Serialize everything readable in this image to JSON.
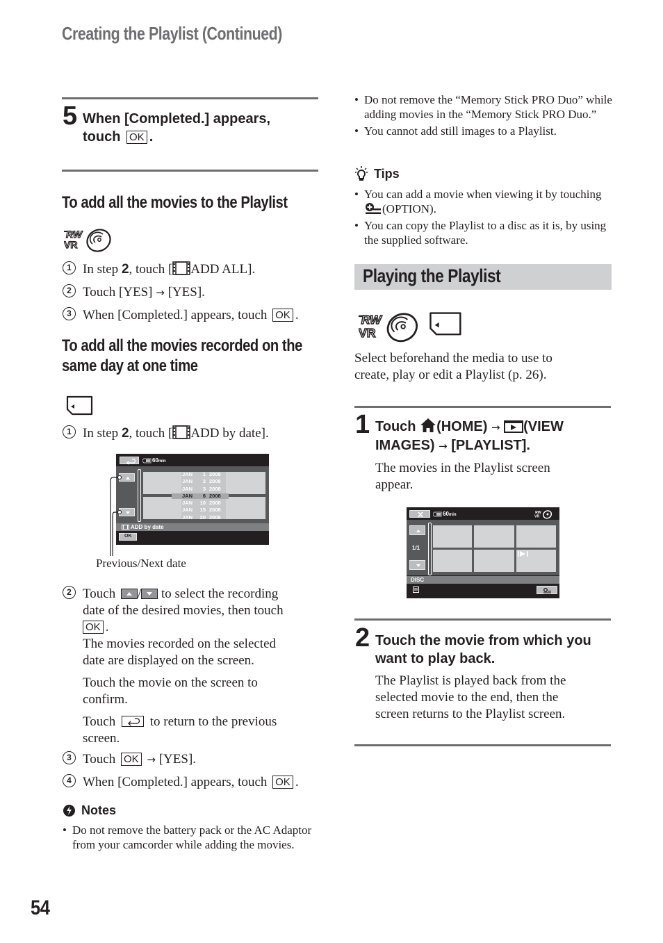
{
  "running_head": "Creating the Playlist (Continued)",
  "page_number": "54",
  "left": {
    "step5": {
      "number": "5",
      "title_line1": "When [Completed.] appears,",
      "title_line2_prefix": "touch",
      "ok_label": "OK",
      "title_suffix": "."
    },
    "add_all": {
      "heading": "To add all the movies to the Playlist",
      "media_icon": "dvd-rw-vr-disc-icon",
      "items": [
        {
          "num": "1",
          "pre": "In step ",
          "bold": "2",
          "mid": ", touch [",
          "icon": "film-strip-icon",
          "post": "ADD ALL]."
        },
        {
          "num": "2",
          "text": "Touch [YES] ",
          "arrow": "→",
          "post": " [YES]."
        },
        {
          "num": "3",
          "text": "When [Completed.] appears, touch",
          "ok": "OK",
          "post": "."
        }
      ]
    },
    "add_by_date": {
      "heading_line1": "To add all the movies recorded on the",
      "heading_line2": "same day at one time",
      "media_icon": "memory-stick-icon",
      "item1": {
        "num": "1",
        "pre": "In step ",
        "bold": "2",
        "mid": ", touch [",
        "icon": "film-strip-icon",
        "post": "ADD by date]."
      },
      "screen": {
        "back_icon": "return-icon",
        "battery_icon": "battery-icon",
        "remaining": "60",
        "remaining_unit": "min",
        "dates": [
          {
            "month": "JAN",
            "day": "1",
            "year": "2008",
            "selected": false
          },
          {
            "month": "JAN",
            "day": "2",
            "year": "2008",
            "selected": false
          },
          {
            "month": "JAN",
            "day": "3",
            "year": "2008",
            "selected": false
          },
          {
            "month": "JAN",
            "day": "6",
            "year": "2008",
            "selected": true
          },
          {
            "month": "JAN",
            "day": "10",
            "year": "2008",
            "selected": false
          },
          {
            "month": "JAN",
            "day": "15",
            "year": "2008",
            "selected": false
          },
          {
            "month": "JAN",
            "day": "20",
            "year": "2008",
            "selected": false
          }
        ],
        "status_label": "ADD by date",
        "ok_label": "OK"
      },
      "callout": "Previous/Next date",
      "item2": {
        "num": "2",
        "pre": "Touch",
        "up_icon": "up-arrow-button-icon",
        "slash": "/",
        "down_icon": "down-arrow-button-icon",
        "line1_post": "to select the recording",
        "line2": "date of the desired movies, then touch",
        "ok": "OK",
        "after_ok": ".",
        "para1_line1": "The movies recorded on the selected",
        "para1_line2": "date are displayed on the screen.",
        "para2_line1": "Touch the movie on the screen to",
        "para2_line2": "confirm.",
        "para3_pre": "Touch",
        "para3_icon": "return-icon",
        "para3_post": "to return to the previous",
        "para3_line2": "screen."
      },
      "item3": {
        "num": "3",
        "pre": "Touch",
        "ok": "OK",
        "arrow": "→",
        "post": "[YES]."
      },
      "item4": {
        "num": "4",
        "pre": "When [Completed.] appears, touch",
        "ok": "OK",
        "post": "."
      }
    },
    "notes": {
      "heading": "Notes",
      "items": [
        "Do not remove the battery pack or the AC Adaptor from your camcorder while adding the movies."
      ]
    }
  },
  "right": {
    "notes_cont": [
      "Do not remove the “Memory Stick PRO Duo” while adding movies in the “Memory Stick PRO Duo.”",
      "You cannot add still images to a Playlist."
    ],
    "tips": {
      "heading": "Tips",
      "item1_pre": "You can add a movie when viewing it by touching",
      "item1_icon": "option-icon",
      "item1_post": "(OPTION).",
      "item2": "You can copy the Playlist to a disc as it is, by using the supplied software."
    },
    "section_title": "Playing the Playlist",
    "media_icons": [
      "dvd-rw-vr-disc-icon",
      "memory-stick-icon"
    ],
    "intro": "Select beforehand the media to use to create, play or edit a Playlist (p. 26).",
    "step1": {
      "number": "1",
      "touch": "Touch",
      "home_icon": "home-icon",
      "home_label": "(HOME)",
      "arrow": "→",
      "view_icon": "view-images-icon",
      "view_label_1": "(VIEW",
      "view_label_2": "IMAGES)",
      "playlist_label": "[PLAYLIST].",
      "body": "The movies in the Playlist screen appear.",
      "screen": {
        "close_icon": "close-icon",
        "battery_icon": "battery-icon",
        "remaining": "60",
        "remaining_unit": "min",
        "media_icon": "dvd-rw-vr-disc-icon",
        "page": "1/1",
        "media_label": "DISC",
        "playlist_icon": "playlist-icon",
        "option_icon": "option-icon",
        "resume_icon": "resume-play-icon"
      }
    },
    "step2": {
      "number": "2",
      "title": "Touch the movie from which you want to play back.",
      "body": "The Playlist is played back from the selected movie to the end, then the screen returns to the Playlist screen."
    }
  }
}
